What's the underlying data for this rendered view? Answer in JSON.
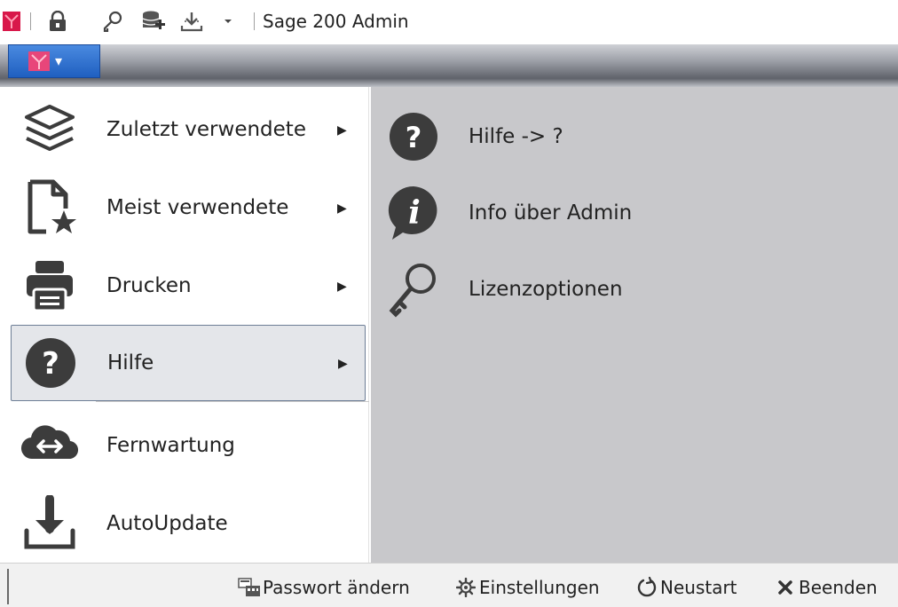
{
  "quick_access": {
    "title": "Sage 200 Admin",
    "icons": [
      "app-logo-icon",
      "lock-icon",
      "key-icon",
      "database-add-icon",
      "download-icon",
      "dropdown-arrow-icon"
    ]
  },
  "ribbon": {
    "app_button_icon": "app-logo-icon",
    "app_button_arrow": "▾"
  },
  "menu": {
    "items": [
      {
        "label": "Zuletzt verwendete",
        "icon": "layers-icon",
        "arrow": "▶"
      },
      {
        "label": "Meist verwendete",
        "icon": "document-star-icon",
        "arrow": "▶"
      },
      {
        "label": "Drucken",
        "icon": "printer-icon",
        "arrow": "▶"
      },
      {
        "label": "Hilfe",
        "icon": "help-icon",
        "arrow": "▶",
        "selected": true
      },
      {
        "label": "Fernwartung",
        "icon": "remote-icon"
      },
      {
        "label": "AutoUpdate",
        "icon": "download-icon"
      }
    ]
  },
  "submenu": {
    "items": [
      {
        "label": "Hilfe -> ?",
        "icon": "help-icon"
      },
      {
        "label": "Info über Admin",
        "icon": "info-icon"
      },
      {
        "label": "Lizenzoptionen",
        "icon": "key-icon"
      }
    ]
  },
  "statusbar": {
    "buttons": [
      {
        "label": "Passwort ändern",
        "icon": "password-icon"
      },
      {
        "label": "Einstellungen",
        "icon": "gear-icon"
      },
      {
        "label": "Neustart",
        "icon": "restart-icon"
      },
      {
        "label": "Beenden",
        "icon": "close-icon"
      }
    ]
  },
  "colors": {
    "brand_red": "#d8184a",
    "app_button_blue": "#2a6ad0",
    "icon_dark": "#3c3c3c",
    "selection_border": "#6e7e96",
    "submenu_bg": "#c8c8cb"
  }
}
